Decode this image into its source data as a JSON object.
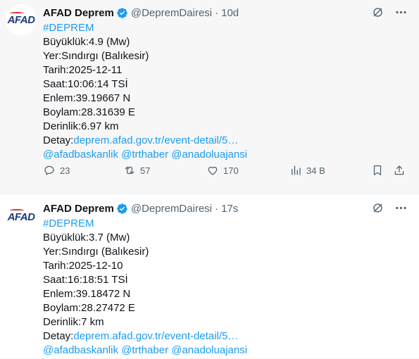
{
  "colors": {
    "accent": "#1d9bf0",
    "muted": "#536471",
    "text": "#0f1419",
    "verified": "#1d9bf0"
  },
  "tweets": [
    {
      "avatar_text": "AFAD",
      "name": "AFAD Deprem",
      "handle": "@DepremDairesi",
      "separator": "·",
      "time": "10d",
      "hashtag": "#DEPREM",
      "lines": [
        "Büyüklük:4.9 (Mw)",
        "Yer:Sındırgı (Balıkesir)",
        "Tarih:2025-12-11",
        "Saat:10:06:14 TSİ",
        "Enlem:39.19667 N",
        "Boylam:28.31639 E",
        "Derinlik:6.97 km"
      ],
      "detail_label": "Detay:",
      "detail_link": "deprem.afad.gov.tr/event-detail/5…",
      "mentions": [
        "@afadbaskanlik",
        "@trthaber",
        "@anadoluajansi"
      ],
      "stats": {
        "replies": "23",
        "retweets": "57",
        "likes": "170",
        "views": "34 B"
      }
    },
    {
      "avatar_text": "AFAD",
      "name": "AFAD Deprem",
      "handle": "@DepremDairesi",
      "separator": "·",
      "time": "17s",
      "hashtag": "#DEPREM",
      "lines": [
        "Büyüklük:3.7 (Mw)",
        "Yer:Sındırgı (Balıkesir)",
        "Tarih:2025-12-10",
        "Saat:16:18:51 TSİ",
        "Enlem:39.18472 N",
        "Boylam:28.27472 E",
        "Derinlik:7 km"
      ],
      "detail_label": "Detay:",
      "detail_link": "deprem.afad.gov.tr/event-detail/5…",
      "mentions": [
        "@afadbaskanlik",
        "@trthaber",
        "@anadoluajansi"
      ]
    }
  ]
}
